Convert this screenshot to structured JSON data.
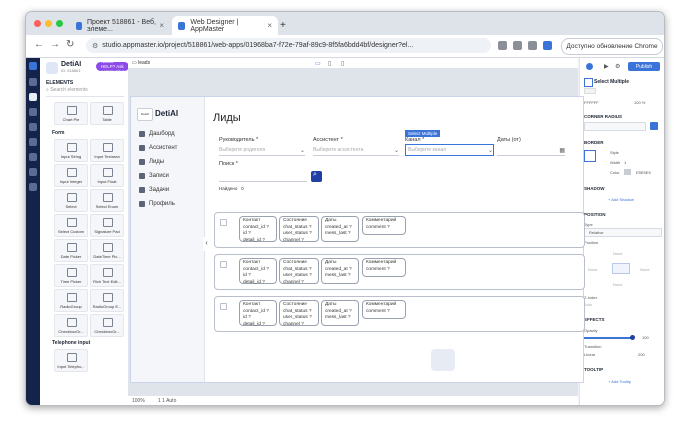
{
  "browser": {
    "tabs": [
      {
        "label": "Проект 518861 - Веб, элеме..."
      },
      {
        "label": "Web Designer | AppMaster"
      }
    ],
    "url": "studio.appmaster.io/project/518861/web-apps/01968ba7-f72e-79af-89c9-8f5fa6bdd4bf/designer?el...",
    "update_button": "Доступно обновление Chrome"
  },
  "app": {
    "project_name": "DetiAI",
    "project_sub": "ID: 518861",
    "need_help": "NEED HELP? Ask community!",
    "page_label": "leads",
    "elements_title": "ELEMENTS",
    "search_placeholder": "Search elements",
    "top_cards": [
      "Chart Pie",
      "Table"
    ],
    "form_title": "Form",
    "form_cards": [
      "Input String",
      "Input Textarea",
      "Input Integer",
      "Input Float",
      "Select",
      "Select Enum",
      "Select Custom",
      "Signature Pad",
      "Date Picker",
      "DateTime Pic...",
      "Time Picker",
      "Rich Text Edit...",
      "RadioGroup",
      "RadioGroup E...",
      "CheckboxGr...",
      "CheckboxGr..."
    ],
    "tel_title": "Telephone input",
    "tel_card": "Input Telepho...",
    "zoom": "100%",
    "bottom_text": "1  1   Auto"
  },
  "preview": {
    "logo_small": "DetiAI",
    "logo_text": "DetiAI",
    "menu": [
      "Дашборд",
      "Ассистент",
      "Лиды",
      "Записи",
      "Задачи",
      "Профиль"
    ],
    "title": "Лиды",
    "filters": {
      "manager_label": "Руководитель *",
      "manager_placeholder": "Выберите родителя",
      "assistant_label": "Ассистент *",
      "assistant_placeholder": "Выберите ассистента",
      "channel_label": "Канал *",
      "channel_placeholder": "Выберите канал",
      "dates_label": "Даты (от)",
      "selected_tag": "Select Multiple",
      "search_label": "Поиск *",
      "found_label": "Найдено",
      "found_count": "0"
    },
    "rows": [
      {
        "contact": [
          "Контакт",
          "contact_id ?",
          "id ?",
          "detail_id ?"
        ],
        "status": [
          "Состояние",
          "chat_status ?",
          "user_status ?",
          "channel ?"
        ],
        "dates": [
          "Даты",
          "created_at ?",
          "mess_last ?"
        ],
        "comment": [
          "Комментарий",
          "comment ?"
        ]
      },
      {
        "contact": [
          "Контакт",
          "contact_id ?",
          "id ?",
          "detail_id ?"
        ],
        "status": [
          "Состояние",
          "chat_status ?",
          "user_status ?",
          "channel ?"
        ],
        "dates": [
          "Даты",
          "created_at ?",
          "mess_last ?"
        ],
        "comment": [
          "Комментарий",
          "comment ?"
        ]
      },
      {
        "contact": [
          "Контакт",
          "contact_id ?",
          "id ?",
          "detail_id ?"
        ],
        "status": [
          "Состояние",
          "chat_status ?",
          "user_status ?",
          "channel ?"
        ],
        "dates": [
          "Даты",
          "created_at ?",
          "mess_last ?"
        ],
        "comment": [
          "Комментарий",
          "comment ?"
        ]
      }
    ]
  },
  "inspector": {
    "publish": "Publish",
    "component": "Select Multiple",
    "color_value": "FFFFFF",
    "color_percent": "100 %",
    "corner_radius": "CORNER RADIUS",
    "border": "BORDER",
    "style_label": "Style",
    "width_label": "Width",
    "width_value": "1",
    "color_label": "Color",
    "border_color": "E5E5E5",
    "shadow": "SHADOW",
    "add_shadow": "+ Add Shadow",
    "position": "POSITION",
    "type_label": "Type",
    "type_value": "Relative",
    "position_label": "Position",
    "none": "None",
    "z_index": "Z-index",
    "auto": "Auto",
    "effects": "EFFECTS",
    "opacity": "Opacity",
    "opacity_value": "100",
    "transition": "Transition",
    "transition_value": "Linear",
    "transition_ms": "200",
    "tooltip": "TOOLTIP",
    "add_tooltip": "+ Add Tooltip"
  },
  "colors": {
    "accent": "#3b74d9",
    "rail": "#14234a",
    "need_help": "#8c4be8"
  }
}
